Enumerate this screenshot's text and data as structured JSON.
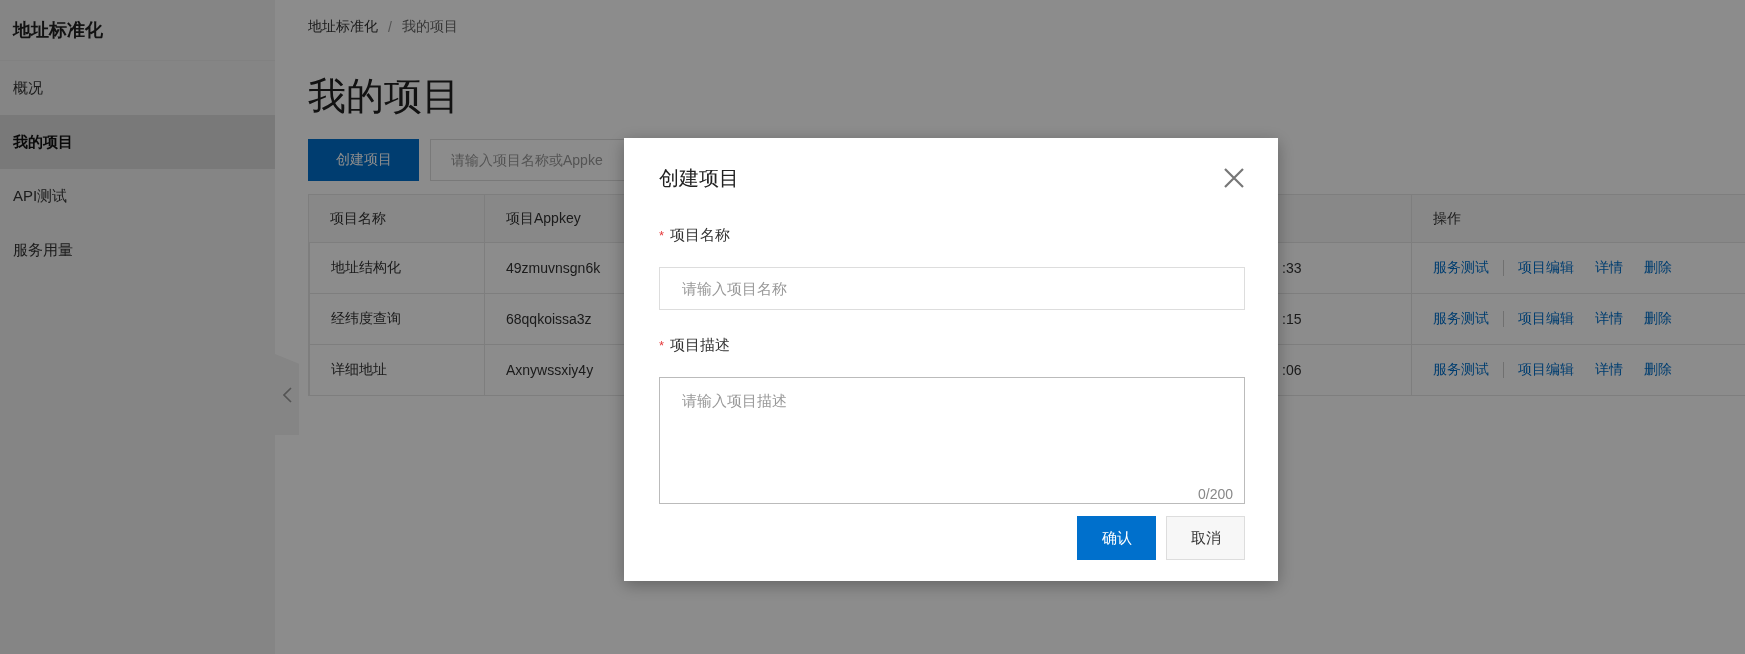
{
  "sidebar": {
    "title": "地址标准化",
    "items": [
      {
        "label": "概况",
        "selected": false
      },
      {
        "label": "我的项目",
        "selected": true
      },
      {
        "label": "API测试",
        "selected": false
      },
      {
        "label": "服务用量",
        "selected": false
      }
    ]
  },
  "breadcrumb": {
    "items": [
      "地址标准化",
      "我的项目"
    ],
    "separator": "/"
  },
  "heading": "我的项目",
  "create_button": "创建项目",
  "search": {
    "placeholder": "请输入项目名称或Appke"
  },
  "table": {
    "columns": [
      "项目名称",
      "项目Appkey",
      "操作"
    ],
    "rows": [
      {
        "name": "地址结构化",
        "appkey": "49zmuvnsgn6k",
        "column_3": ":33",
        "actions": [
          "服务测试",
          "项目编辑",
          "详情",
          "删除"
        ]
      },
      {
        "name": "经纬度查询",
        "appkey": "68qqkoissa3z",
        "column_3": ":15",
        "actions": [
          "服务测试",
          "项目编辑",
          "详情",
          "删除"
        ]
      },
      {
        "name": "详细地址",
        "appkey": "Axnywssxiy4y",
        "column_3": ":06",
        "actions": [
          "服务测试",
          "项目编辑",
          "详情",
          "删除"
        ]
      }
    ]
  },
  "dialog": {
    "title": "创建项目",
    "fields": [
      {
        "kind": "input",
        "label": "项目名称",
        "required_mark": "*",
        "placeholder": "请输入项目名称"
      },
      {
        "kind": "textarea",
        "label": "项目描述",
        "required_mark": "*",
        "placeholder": "请输入项目描述",
        "counter": "0/200"
      }
    ],
    "buttons": [
      {
        "label": "确认",
        "kind": "primary"
      },
      {
        "label": "取消",
        "kind": "secondary"
      }
    ]
  }
}
